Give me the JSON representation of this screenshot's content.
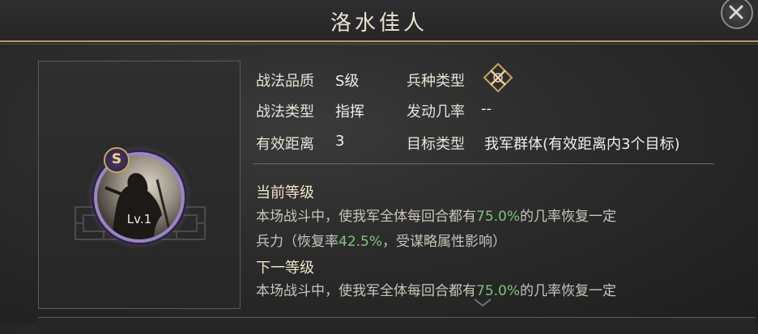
{
  "window": {
    "title": "洛水佳人"
  },
  "skill": {
    "grade_letter": "S",
    "level_text": "Lv.1"
  },
  "attributes": {
    "quality_label": "战法品质",
    "quality_value": "S级",
    "type_label": "战法类型",
    "type_value": "指挥",
    "range_label": "有效距离",
    "range_value": "3",
    "troop_label": "兵种类型",
    "troop_icon": "crossed-weapons-icon",
    "chance_label": "发动几率",
    "chance_value": "--",
    "target_label": "目标类型",
    "target_value": "我军群体(有效距离内3个目标)"
  },
  "current_level": {
    "heading": "当前等级",
    "line1_a": "本场战斗中，使我军全体每回合都有",
    "line1_hl": "75.0%",
    "line1_b": "的几率恢复一定",
    "line2_a": "兵力（恢复率",
    "line2_hl": "42.5%",
    "line2_b": "，受谋略属性影响）"
  },
  "next_level": {
    "heading": "下一等级",
    "line1_a": "本场战斗中，使我军全体每回合都有",
    "line1_hl": "75.0%",
    "line1_b": "的几率恢复一定"
  },
  "colors": {
    "accent_gold": "#b99a64",
    "highlight_green": "#7fc47a",
    "portrait_ring": "#9b85c7"
  }
}
